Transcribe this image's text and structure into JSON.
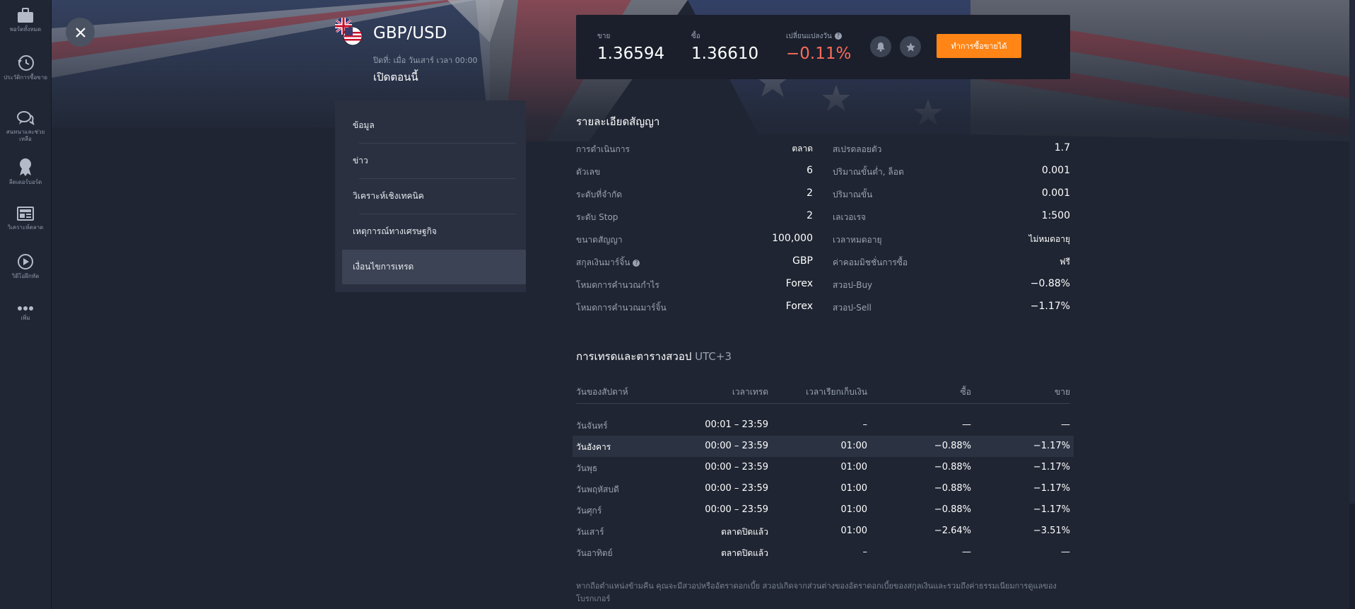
{
  "sidebar": {
    "items": [
      {
        "icon": "briefcase-icon",
        "label": "พอร์ตทั้งหมด"
      },
      {
        "icon": "history-icon",
        "label": "ประวัติการซื้อขาย"
      },
      {
        "icon": "chat-icon",
        "label": "สนทนาและช่วยเหลือ"
      },
      {
        "icon": "award-icon",
        "label": "ลีดเดอร์บอร์ด"
      },
      {
        "icon": "news-icon",
        "label": "วิเคราะห์ตลาด"
      },
      {
        "icon": "play-icon",
        "label": "วิดีโอฝึกหัด"
      },
      {
        "icon": "more-icon",
        "label": "เพิ่ม"
      }
    ]
  },
  "instrument": {
    "name": "GBP/USD",
    "closes": "ปิดที่: เมื่อ วันเสาร์ เวลา 00:00",
    "status": "เปิดตอนนี้"
  },
  "quote": {
    "sell_label": "ขาย",
    "sell_value": "1.36594",
    "buy_label": "ซื้อ",
    "buy_value": "1.36610",
    "change_label": "เปลี่ยนแปลงวัน",
    "change_value": "−0.11%",
    "trade_button": "ทำการซื้อขายได้",
    "colors": {
      "negative": "#ff6b5b",
      "button": "#ff8516"
    }
  },
  "menu": {
    "items": [
      "ข้อมูล",
      "ข่าว",
      "วิเคราะห์เชิงเทคนิค",
      "เหตุการณ์ทางเศรษฐกิจ",
      "เงื่อนไขการเทรด"
    ],
    "active": "เงื่อนไขการเทรด"
  },
  "contract": {
    "title": "รายละเอียดสัญญา",
    "left": [
      {
        "label": "การดำเนินการ",
        "value": "ตลาด"
      },
      {
        "label": "ตัวเลข",
        "value": "6"
      },
      {
        "label": "ระดับที่จำกัด",
        "value": "2"
      },
      {
        "label": "ระดับ Stop",
        "value": "2"
      },
      {
        "label": "ขนาดสัญญา",
        "value": "100,000"
      },
      {
        "label": "สกุลเงินมาร์จิ้น",
        "value": "GBP"
      },
      {
        "label": "โหมดการคำนวณกำไร",
        "value": "Forex"
      },
      {
        "label": "โหมดการคำนวณมาร์จิ้น",
        "value": "Forex"
      }
    ],
    "right": [
      {
        "label": "สเปรดลอยตัว",
        "value": "1.7"
      },
      {
        "label": "ปริมาณขั้นต่ำ, ล็อต",
        "value": "0.001"
      },
      {
        "label": "ปริมาณขั้น",
        "value": "0.001"
      },
      {
        "label": "เลเวอเรจ",
        "value": "1:500"
      },
      {
        "label": "เวลาหมดอายุ",
        "value": "ไม่หมดอายุ"
      },
      {
        "label": "ค่าคอมมิชชั่นการซื้อ",
        "value": "ฟรี"
      },
      {
        "label": "สวอป-Buy",
        "value": "−0.88%"
      },
      {
        "label": "สวอป-Sell",
        "value": "−1.17%"
      }
    ]
  },
  "schedule": {
    "title": "การเทรดและตารางสวอป",
    "timezone": "UTC+3",
    "headers": [
      "วันของสัปดาห์",
      "เวลาเทรด",
      "เวลาเรียกเก็บเงิน",
      "ซื้อ",
      "ขาย"
    ],
    "rows": [
      [
        "วันจันทร์",
        "00:01 – 23:59",
        "–",
        "—",
        "—"
      ],
      [
        "วันอังคาร",
        "00:00 – 23:59",
        "01:00",
        "−0.88%",
        "−1.17%"
      ],
      [
        "วันพุธ",
        "00:00 – 23:59",
        "01:00",
        "−0.88%",
        "−1.17%"
      ],
      [
        "วันพฤหัสบดี",
        "00:00 – 23:59",
        "01:00",
        "−0.88%",
        "−1.17%"
      ],
      [
        "วันศุกร์",
        "00:00 – 23:59",
        "01:00",
        "−0.88%",
        "−1.17%"
      ],
      [
        "วันเสาร์",
        "ตลาดปิดแล้ว",
        "01:00",
        "−2.64%",
        "−3.51%"
      ],
      [
        "วันอาทิตย์",
        "ตลาดปิดแล้ว",
        "–",
        "—",
        "—"
      ]
    ],
    "highlighted_row": "วันอังคาร"
  },
  "footnote": "หากถือตำแหน่งข้ามคืน คุณจะมีสวอปหรืออัตราดอกเบี้ย สวอปเกิดจากส่วนต่างของอัตราดอกเบี้ยของสกุลเงินและรวมถึงค่าธรรมเนียมการดูแลของโบรกเกอร์"
}
